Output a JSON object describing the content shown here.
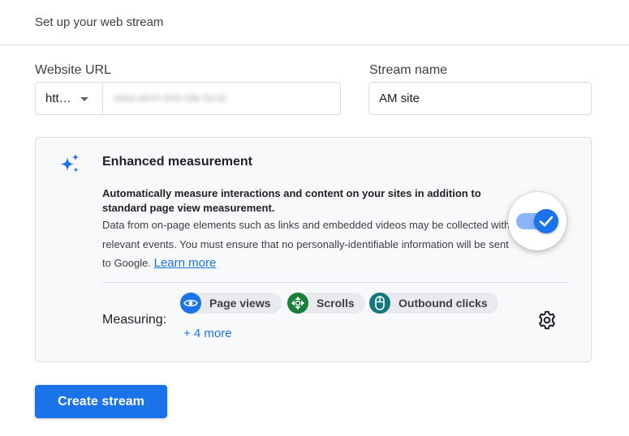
{
  "header": {
    "title": "Set up your web stream"
  },
  "url_field": {
    "label": "Website URL",
    "protocol": "htt…",
    "value": "www.alvin-test-site.local"
  },
  "name_field": {
    "label": "Stream name",
    "value": "AM site"
  },
  "enhanced": {
    "title": "Enhanced measurement",
    "bold_text": "Automatically measure interactions and content on your sites in addition to standard page view measurement.",
    "description": "Data from on-page elements such as links and embedded videos may be collected with relevant events. You must ensure that no personally-identifiable information will be sent to Google.",
    "learn_more": "Learn more",
    "toggle_on": true,
    "measuring_label": "Measuring:",
    "chips": [
      {
        "label": "Page views",
        "icon": "eye-icon",
        "color": "#1a73e8"
      },
      {
        "label": "Scrolls",
        "icon": "scroll-arrows-icon",
        "color": "#188038"
      },
      {
        "label": "Outbound clicks",
        "icon": "mouse-icon",
        "color": "#12787c"
      }
    ],
    "more": "+ 4 more"
  },
  "create_button": "Create stream",
  "colors": {
    "accent": "#1a73e8",
    "card_bg": "#f8f9fa",
    "border": "#dadce0"
  }
}
